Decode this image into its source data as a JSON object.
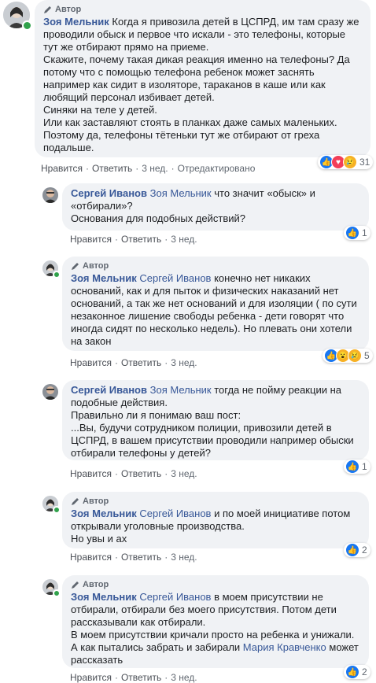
{
  "author_badge": "Автор",
  "comments": [
    {
      "author": "Зоя Мельник",
      "paragraphs": [
        "Когда я привозила детей в ЦСПРД, им там сразу же проводили обыск и первое что искали - это телефоны, которые тут же отбирают прямо на приеме.",
        "Скажите, почему такая дикая реакция именно на телефоны? Да потому что с помощью телефона ребенок может заснять например как сидит в изоляторе, тараканов в каше или как любящий персонал избивает детей.",
        "Синяки на теле у детей.",
        "Или как заставляют стоять в планках даже самых маленьких.",
        "Поэтому да, телефоны тётеньки тут же отбирают от греха подальше."
      ],
      "like": "Нравится",
      "reply": "Ответить",
      "time": "3 нед.",
      "edited": "Отредактировано",
      "reaction_count": "31"
    },
    {
      "author": "Сергей Иванов",
      "mention": "Зоя Мельник",
      "paragraphs": [
        "что значит «обыск» и «отбирали»?",
        "Основания для подобных действий?"
      ],
      "like": "Нравится",
      "reply": "Ответить",
      "time": "3 нед.",
      "reaction_count": "1"
    },
    {
      "author": "Зоя Мельник",
      "mention": "Сергей Иванов",
      "paragraphs": [
        "конечно нет никаких оснований, как и для пыток и физических наказаний нет оснований, а так же нет оснований и для изоляции ( по сути незаконное лишение свободы ребенка - дети говорят что иногда сидят по несколько недель). Но плевать они хотели на закон"
      ],
      "like": "Нравится",
      "reply": "Ответить",
      "time": "3 нед.",
      "reaction_count": "5"
    },
    {
      "author": "Сергей Иванов",
      "mention": "Зоя Мельник",
      "paragraphs": [
        "тогда не пойму реакции на подобные действия.",
        "Правильно ли я понимаю ваш пост:",
        "...Вы, будучи сотрудником полиции, привозили детей в ЦСПРД, в вашем присутствии проводили например обыски отбирали телефоны у детей?"
      ],
      "like": "Нравится",
      "reply": "Ответить",
      "time": "3 нед.",
      "reaction_count": "1"
    },
    {
      "author": "Зоя Мельник",
      "mention": "Сергей Иванов",
      "paragraphs": [
        "и по моей инициативе потом открывали уголовные производства.",
        "Но увы и ах"
      ],
      "like": "Нравится",
      "reply": "Ответить",
      "time": "3 нед.",
      "reaction_count": "2"
    },
    {
      "author": "Зоя Мельник",
      "mention": "Сергей Иванов",
      "paragraphs": [
        "в моем присутствии не отбирали, отбирали без моего присутствия. Потом дети рассказывали как отбирали.",
        "В моем присутствии кричали просто на ребенка и унижали.",
        "А как пытались забрать и забирали"
      ],
      "mention_inline": "Мария Кравченко",
      "tail": "может рассказать",
      "like": "Нравится",
      "reply": "Ответить",
      "time": "3 нед.",
      "reaction_count": "2"
    }
  ]
}
